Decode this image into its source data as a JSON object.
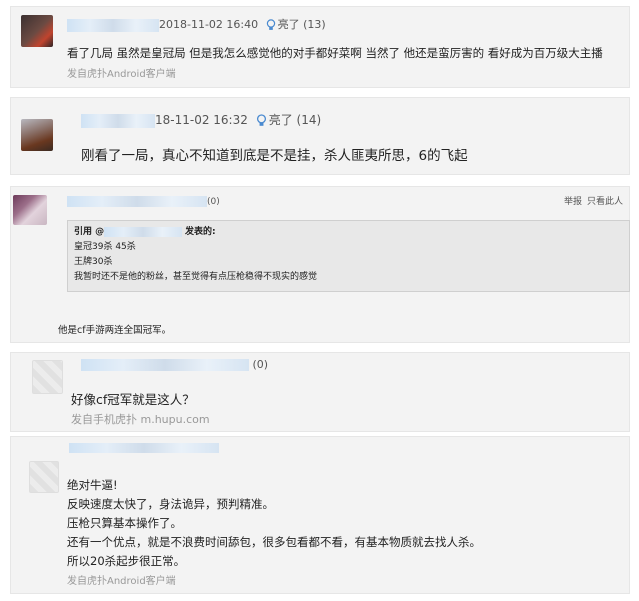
{
  "posts": [
    {
      "timestamp": "2018-11-02 16:40",
      "light_label": "亮了",
      "light_count": "(13)",
      "body": "看了几局 虽然是皇冠局 但是我怎么感觉他的对手都好菜啊 当然了 他还是蛮厉害的 看好成为百万级大主播",
      "source": "发自虎扑Android客户端"
    },
    {
      "timestamp": "18-11-02 16:32",
      "light_label": "亮了",
      "light_count": "(14)",
      "body": "刚看了一局，真心不知道到底是不是挂，杀人匪夷所思，6的飞起"
    },
    {
      "count": "(0)",
      "actions": [
        "举报",
        "只看此人"
      ],
      "quote": {
        "head_prefix": "引用 @",
        "head_suffix": "发表的:",
        "lines": [
          "皇冠39杀 45杀",
          "王牌30杀",
          "我暂时还不是他的粉丝，甚至觉得有点压枪稳得不现实的感觉"
        ]
      },
      "body": "他是cf手游两连全国冠军。"
    },
    {
      "count": "(0)",
      "body": "好像cf冠军就是这人？",
      "source": "发自手机虎扑 m.hupu.com"
    },
    {
      "lines": [
        "绝对牛逼!",
        "反映速度太快了，身法诡异，预判精准。",
        "压枪只算基本操作了。",
        "还有一个优点，就是不浪费时间舔包，很多包看都不看，有基本物质就去找人杀。",
        "所以20杀起步很正常。"
      ],
      "source": "发自虎扑Android客户端"
    }
  ]
}
